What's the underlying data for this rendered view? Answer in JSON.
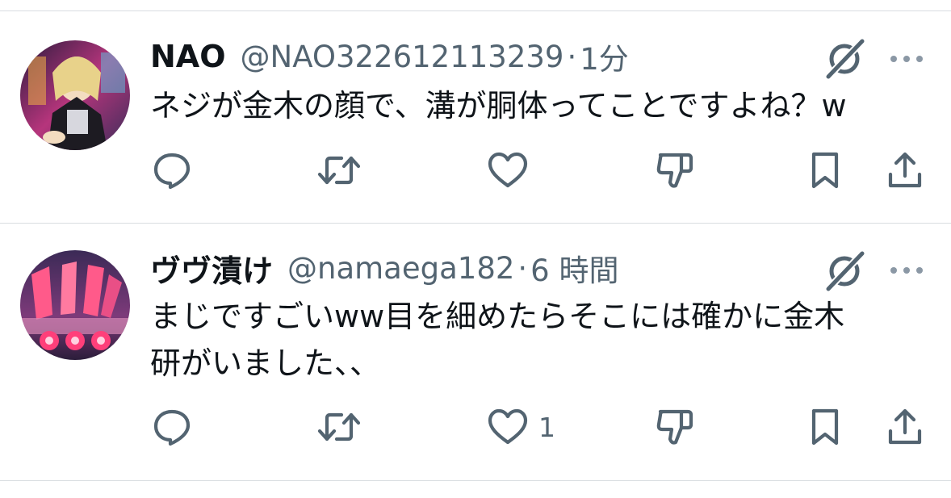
{
  "tweets": [
    {
      "display_name": "NAO",
      "handle": "@NAO322612113239",
      "separator": "·",
      "time": "1分",
      "text_lines": [
        "ネジが金木の顔で、溝が胴体ってことですよね？w"
      ],
      "like_count": ""
    },
    {
      "display_name": "ヴヴ漬け",
      "handle": "@namaega182",
      "separator": "·",
      "time": "6 時間",
      "text_lines": [
        "まじですごいww目を細めたらそこには確かに金木",
        "研がいました、、"
      ],
      "like_count": "1"
    }
  ],
  "colors": {
    "text": "#0f1419",
    "secondary": "#536471",
    "divider": "#d9dde1"
  },
  "icons": [
    "grok-icon",
    "more-icon",
    "reply-icon",
    "retweet-icon",
    "like-icon",
    "dislike-icon",
    "bookmark-icon",
    "share-icon"
  ]
}
